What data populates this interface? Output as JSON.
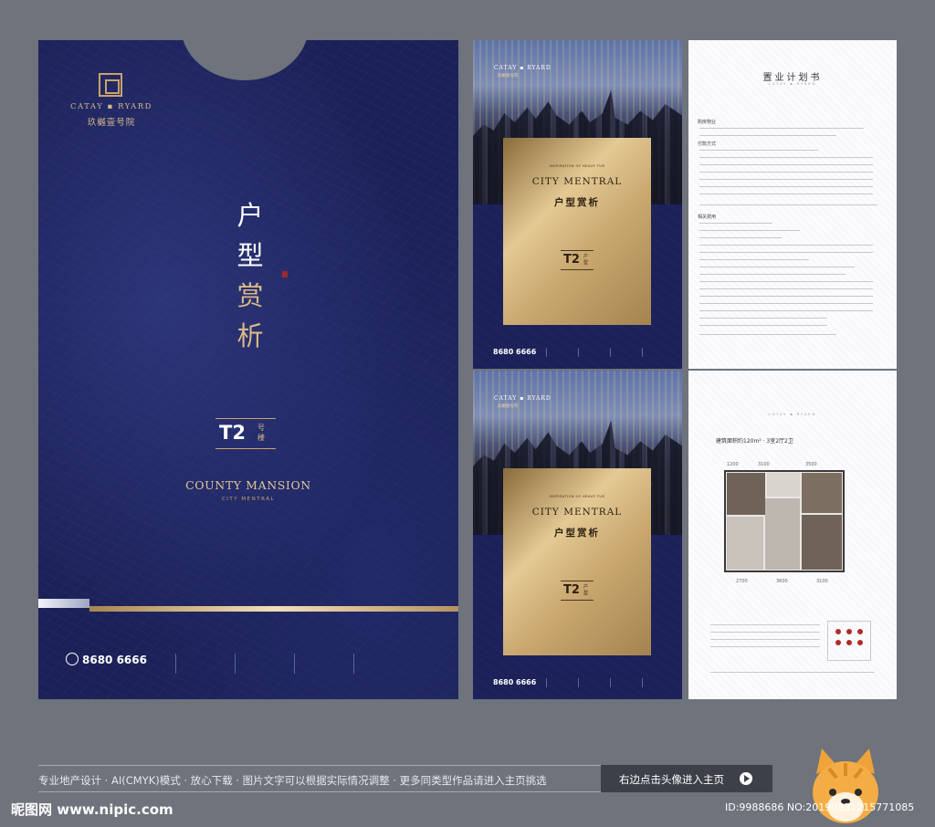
{
  "folder": {
    "brand_en": "CATAY ▪ RYARD",
    "brand_cn": "玖樾壹号院",
    "title_chars": [
      "户",
      "型",
      "赏",
      "析"
    ],
    "t2": "T2",
    "t2_small": "号楼",
    "county": "COUNTY MANSION",
    "city": "CITY MENTRAL",
    "phone": "8680 6666"
  },
  "card": {
    "brand_en": "CATAY ▪ RYARD",
    "brand_cn": "玖樾壹号院",
    "insp": "INSPIRATION OF HEAVE TUR",
    "cm": "CITY MENTRAL",
    "hx": "户型赏析",
    "t2": "T2",
    "t2_small": "户型",
    "phone": "8680 6666"
  },
  "plan_page": {
    "title": "置业计划书",
    "subtitle": "CATAY ▪ RYARD",
    "sec1": "购房物业",
    "sec2": "付款方式",
    "sec3": "相关费用"
  },
  "floor_page": {
    "subtitle": "CATAY ▪ RYARD",
    "area": "建筑面积约120m² · 3室2厅2卫",
    "dims_top": [
      "1200",
      "3100",
      "3500"
    ],
    "dims_bottom": [
      "2700",
      "3600",
      "3100"
    ]
  },
  "footer": {
    "desc": "专业地产设计 · AI(CMYK)模式 · 放心下载 · 图片文字可以根据实际情况调整 · 更多同类型作品请进入主页挑选",
    "cta": "右边点击头像进入主页",
    "site": "昵图网 www.nipic.com",
    "id": "ID:9988686 NO:20190831215771085"
  },
  "colors": {
    "navy": "#1b2157",
    "gold": "#d8b886",
    "bg": "#6e737c"
  }
}
